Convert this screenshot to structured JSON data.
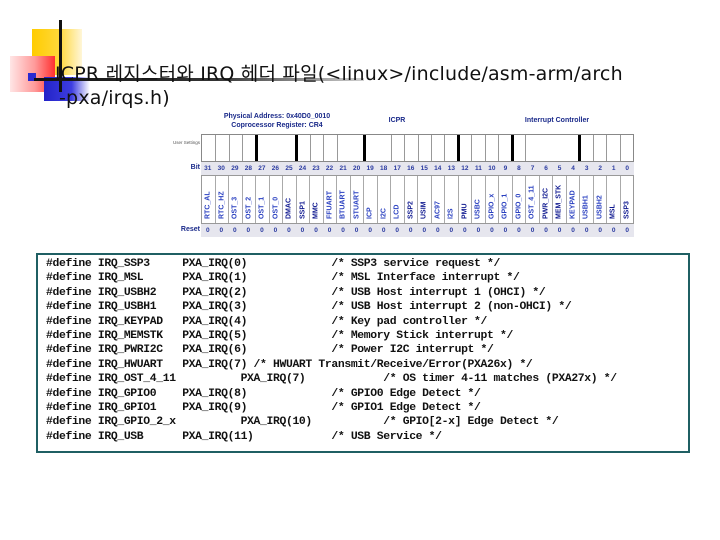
{
  "slide": {
    "title_line1": "ICPR 레지스터와 IRQ 헤더 파일(<linux>/include/asm-arm/arch",
    "title_line2": "-pxa/irqs.h)"
  },
  "register": {
    "address_line1": "Physical Address: 0x40D0_0010",
    "address_line2": "Coprocessor Register: CR4",
    "name": "ICPR",
    "unit": "Interrupt Controller",
    "row_labels": {
      "user_settings": "User Settings",
      "bit": "Bit",
      "reset": "Reset"
    },
    "bits": [
      "31",
      "30",
      "29",
      "28",
      "27",
      "26",
      "25",
      "24",
      "23",
      "22",
      "21",
      "20",
      "19",
      "18",
      "17",
      "16",
      "15",
      "14",
      "13",
      "12",
      "11",
      "10",
      "9",
      "8",
      "7",
      "6",
      "5",
      "4",
      "3",
      "2",
      "1",
      "0"
    ],
    "fields": [
      {
        "name": "RTC_AL",
        "dark": false
      },
      {
        "name": "RTC_HZ",
        "dark": false
      },
      {
        "name": "OST_3",
        "dark": false
      },
      {
        "name": "OST_2",
        "dark": false
      },
      {
        "name": "OST_1",
        "dark": false
      },
      {
        "name": "OST_0",
        "dark": false
      },
      {
        "name": "DMAC",
        "dark": true
      },
      {
        "name": "SSP1",
        "dark": true
      },
      {
        "name": "MMC",
        "dark": true
      },
      {
        "name": "FFUART",
        "dark": false
      },
      {
        "name": "BTUART",
        "dark": false
      },
      {
        "name": "STUART",
        "dark": false
      },
      {
        "name": "ICP",
        "dark": false
      },
      {
        "name": "I2C",
        "dark": false
      },
      {
        "name": "LCD",
        "dark": false
      },
      {
        "name": "SSP2",
        "dark": true
      },
      {
        "name": "USIM",
        "dark": true
      },
      {
        "name": "AC97",
        "dark": false
      },
      {
        "name": "I2S",
        "dark": false
      },
      {
        "name": "PMU",
        "dark": true
      },
      {
        "name": "USBC",
        "dark": false
      },
      {
        "name": "GPIO_x",
        "dark": false
      },
      {
        "name": "GPIO_1",
        "dark": false
      },
      {
        "name": "GPIO_0",
        "dark": false
      },
      {
        "name": "OST_4_11",
        "dark": false
      },
      {
        "name": "PWR_I2C",
        "dark": true
      },
      {
        "name": "MEM_STK",
        "dark": true
      },
      {
        "name": "KEYPAD",
        "dark": false
      },
      {
        "name": "USBH1",
        "dark": false
      },
      {
        "name": "USBH2",
        "dark": false
      },
      {
        "name": "MSL",
        "dark": true
      },
      {
        "name": "SSP3",
        "dark": true
      }
    ],
    "reset": [
      "0",
      "0",
      "0",
      "0",
      "0",
      "0",
      "0",
      "0",
      "0",
      "0",
      "0",
      "0",
      "0",
      "0",
      "0",
      "0",
      "0",
      "0",
      "0",
      "0",
      "0",
      "0",
      "0",
      "0",
      "0",
      "0",
      "0",
      "0",
      "0",
      "0",
      "0",
      "0"
    ]
  },
  "code_lines": [
    "#define IRQ_SSP3     PXA_IRQ(0)             /* SSP3 service request */",
    "#define IRQ_MSL      PXA_IRQ(1)             /* MSL Interface interrupt */",
    "#define IRQ_USBH2    PXA_IRQ(2)             /* USB Host interrupt 1 (OHCI) */",
    "#define IRQ_USBH1    PXA_IRQ(3)             /* USB Host interrupt 2 (non-OHCI) */",
    "#define IRQ_KEYPAD   PXA_IRQ(4)             /* Key pad controller */",
    "#define IRQ_MEMSTK   PXA_IRQ(5)             /* Memory Stick interrupt */",
    "#define IRQ_PWRI2C   PXA_IRQ(6)             /* Power I2C interrupt */",
    "#define IRQ_HWUART   PXA_IRQ(7) /* HWUART Transmit/Receive/Error(PXA26x) */",
    "#define IRQ_OST_4_11          PXA_IRQ(7)            /* OS timer 4-11 matches (PXA27x) */",
    "#define IRQ_GPIO0    PXA_IRQ(8)             /* GPIO0 Edge Detect */",
    "#define IRQ_GPIO1    PXA_IRQ(9)             /* GPIO1 Edge Detect */",
    "#define IRQ_GPIO_2_x          PXA_IRQ(10)           /* GPIO[2-x] Edge Detect */",
    "#define IRQ_USB      PXA_IRQ(11)            /* USB Service */"
  ]
}
